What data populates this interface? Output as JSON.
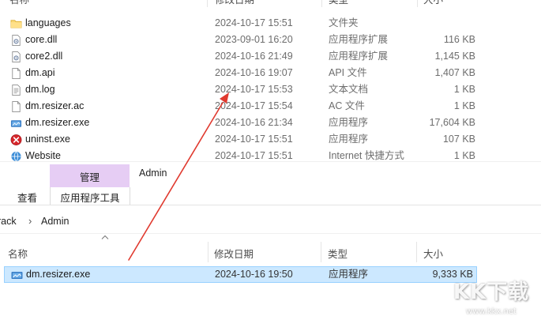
{
  "top_list": {
    "columns": {
      "name": "名称",
      "modified": "修改日期",
      "type": "类型",
      "size": "大小"
    },
    "rows": [
      {
        "icon": "folder-icon",
        "name": "languages",
        "modified": "2024-10-17 15:51",
        "type": "文件夹",
        "size": ""
      },
      {
        "icon": "dll-file-icon",
        "name": "core.dll",
        "modified": "2023-09-01 16:20",
        "type": "应用程序扩展",
        "size": "116 KB"
      },
      {
        "icon": "dll-file-icon",
        "name": "core2.dll",
        "modified": "2024-10-16 21:49",
        "type": "应用程序扩展",
        "size": "1,145 KB"
      },
      {
        "icon": "file-icon",
        "name": "dm.api",
        "modified": "2024-10-16 19:07",
        "type": "API 文件",
        "size": "1,407 KB"
      },
      {
        "icon": "text-file-icon",
        "name": "dm.log",
        "modified": "2024-10-17 15:53",
        "type": "文本文档",
        "size": "1 KB"
      },
      {
        "icon": "file-icon",
        "name": "dm.resizer.ac",
        "modified": "2024-10-17 15:54",
        "type": "AC 文件",
        "size": "1 KB"
      },
      {
        "icon": "app-exe-icon",
        "name": "dm.resizer.exe",
        "modified": "2024-10-16 21:34",
        "type": "应用程序",
        "size": "17,604 KB"
      },
      {
        "icon": "uninstall-icon",
        "name": "uninst.exe",
        "modified": "2024-10-17 15:51",
        "type": "应用程序",
        "size": "107 KB"
      },
      {
        "icon": "shortcut-icon",
        "name": "Website",
        "modified": "2024-10-17 15:51",
        "type": "Internet 快捷方式",
        "size": "1 KB"
      }
    ]
  },
  "ribbon": {
    "context_tab": "管理",
    "title": "Admin",
    "view_tab": "查看",
    "app_tools_tab": "应用程序工具"
  },
  "address_bar": {
    "segments": [
      "rack",
      "Admin"
    ]
  },
  "bottom_list": {
    "columns": {
      "name": "名称",
      "modified": "修改日期",
      "type": "类型",
      "size": "大小"
    },
    "selected_row": {
      "icon": "app-exe-icon",
      "name": "dm.resizer.exe",
      "modified": "2024-10-16 19:50",
      "type": "应用程序",
      "size": "9,333 KB"
    }
  },
  "watermark": {
    "text": "KK下载",
    "url": "www.kkx.net"
  },
  "colors": {
    "accent_arrow": "#e03a2f",
    "selection": "#cce8ff",
    "context_tab": "#e6cdf4"
  }
}
